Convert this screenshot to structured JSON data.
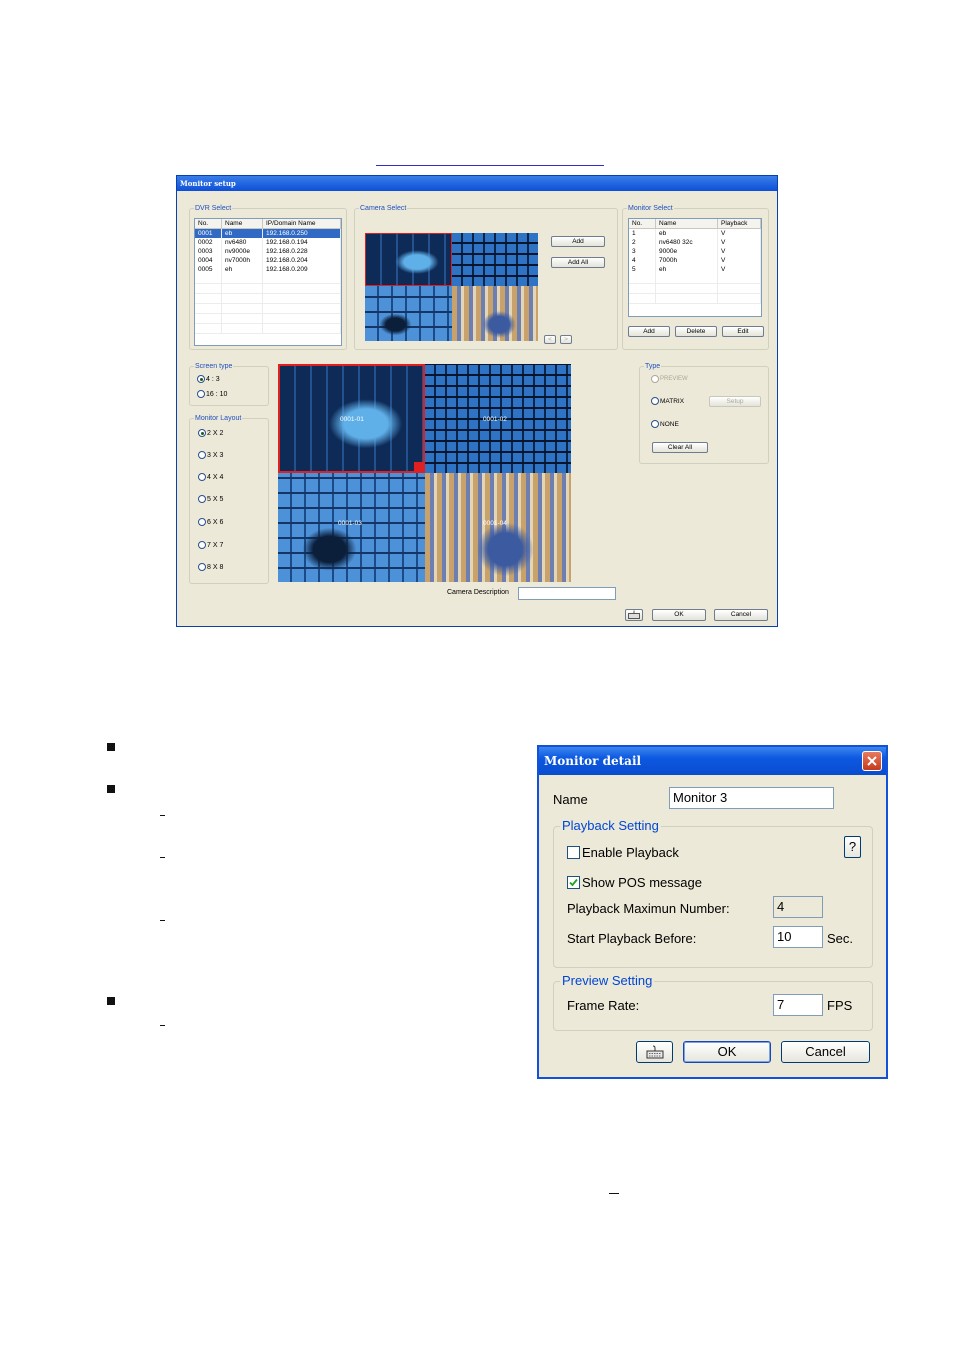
{
  "monitor_setup": {
    "title": "Monitor setup",
    "dvr_select": {
      "group_label": "DVR Select",
      "columns": [
        "No.",
        "Name",
        "IP/Domain Name"
      ],
      "rows": [
        [
          "0001",
          "eb",
          "192.168.0.250"
        ],
        [
          "0002",
          "nv6480",
          "192.168.0.194"
        ],
        [
          "0003",
          "nv9000e",
          "192.168.0.228"
        ],
        [
          "0004",
          "nv7000h",
          "192.168.0.204"
        ],
        [
          "0005",
          "eh",
          "192.168.0.209"
        ]
      ],
      "selected_row": 0
    },
    "camera_select": {
      "group_label": "Camera Select",
      "add_label": "Add",
      "add_all_label": "Add All",
      "prev_label": "<",
      "next_label": ">"
    },
    "monitor_select": {
      "group_label": "Monitor Select",
      "columns": [
        "No.",
        "Name",
        "Playback"
      ],
      "rows": [
        [
          "1",
          "eb",
          "V"
        ],
        [
          "2",
          "nv6480 32c",
          "V"
        ],
        [
          "3",
          "9000e",
          "V"
        ],
        [
          "4",
          "7000h",
          "V"
        ],
        [
          "5",
          "eh",
          "V"
        ]
      ],
      "add_label": "Add",
      "delete_label": "Delete",
      "edit_label": "Edit"
    },
    "screen_type": {
      "group_label": "Screen type",
      "options": [
        "4 : 3",
        "16 : 10"
      ],
      "selected": "4 : 3"
    },
    "monitor_layout": {
      "group_label": "Monitor Layout",
      "options": [
        "2 X 2",
        "3 X 3",
        "4 X 4",
        "5 X 5",
        "6 X 6",
        "7 X 7",
        "8 X 8"
      ],
      "selected": "2 X 2"
    },
    "preview": {
      "cells": [
        "0001-01",
        "0001-02",
        "0001-03",
        "0001-04"
      ]
    },
    "type": {
      "group_label": "Type",
      "preview_label": "PREVIEW",
      "matrix_label": "MATRIX",
      "setup_label": "Setup",
      "none_label": "NONE",
      "clear_all_label": "Clear All"
    },
    "camera_description_label": "Camera Description",
    "camera_description_value": "",
    "keyboard_icon": "keyboard-icon",
    "ok_label": "OK",
    "cancel_label": "Cancel"
  },
  "monitor_detail": {
    "title": "Monitor detail",
    "name_label": "Name",
    "name_value": "Monitor 3",
    "playback_group": "Playback Setting",
    "help_label": "?",
    "enable_playback_label": "Enable Playback",
    "enable_playback_checked": false,
    "show_pos_label": "Show POS message",
    "show_pos_checked": true,
    "max_number_label": "Playback Maximun Number:",
    "max_number_value": "4",
    "start_before_label": "Start Playback Before:",
    "start_before_value": "10",
    "start_before_unit": "Sec.",
    "preview_group": "Preview Setting",
    "frame_rate_label": "Frame Rate:",
    "frame_rate_value": "7",
    "frame_rate_unit": "FPS",
    "keyboard_icon": "keyboard-icon",
    "ok_label": "OK",
    "cancel_label": "Cancel"
  },
  "colors": {
    "xp_title_blue": "#0c58e0",
    "dialog_bg": "#ece9d8",
    "selection_red": "#e02020",
    "group_title_blue": "#0046d5"
  }
}
